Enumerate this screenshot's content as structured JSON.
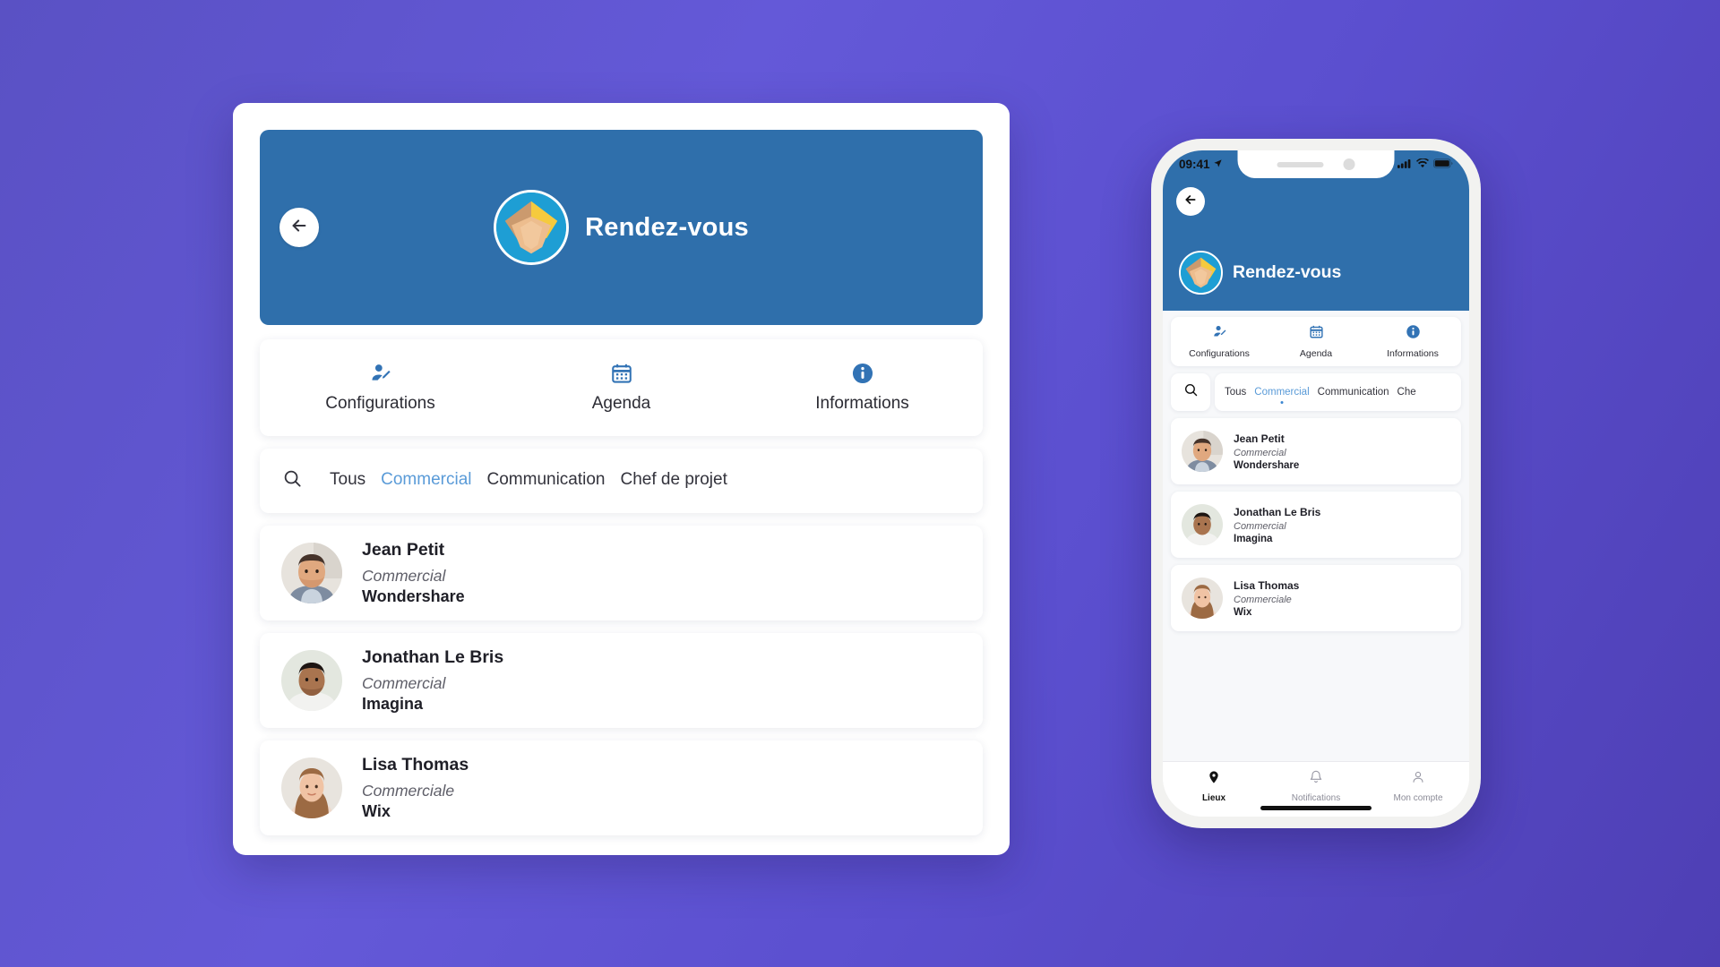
{
  "theme": {
    "page_background": "#5a51c4",
    "header_blue": "#2f6fab",
    "accent_blue": "#3b86d1",
    "active_chip_color": "#5a9bd8",
    "card_white": "#ffffff"
  },
  "desktop": {
    "back_button_icon": "arrow-left-icon",
    "header": {
      "title": "Rendez-vous",
      "logo_icon": "handshake-logo"
    },
    "tabs": [
      {
        "label": "Configurations",
        "icon": "user-edit-icon"
      },
      {
        "label": "Agenda",
        "icon": "calendar-icon"
      },
      {
        "label": "Informations",
        "icon": "info-circle-icon"
      }
    ],
    "filter": {
      "search_icon": "search-icon",
      "chips": [
        {
          "label": "Tous",
          "active": false
        },
        {
          "label": "Commercial",
          "active": true
        },
        {
          "label": "Communication",
          "active": false
        },
        {
          "label": "Chef de projet",
          "active": false
        }
      ]
    },
    "contacts": [
      {
        "name": "Jean Petit",
        "role": "Commercial",
        "organization": "Wondershare",
        "avatar": "photo-man-beard"
      },
      {
        "name": "Jonathan Le Bris",
        "role": "Commercial",
        "organization": "Imagina",
        "avatar": "photo-man-dark"
      },
      {
        "name": "Lisa Thomas",
        "role": "Commerciale",
        "organization": "Wix",
        "avatar": "photo-woman"
      }
    ]
  },
  "phone": {
    "statusbar": {
      "time": "09:41",
      "location_icon": "location-arrow-icon",
      "signal_icon": "cellular-bars-icon",
      "wifi_icon": "wifi-icon",
      "battery_icon": "battery-full-icon"
    },
    "back_button_icon": "arrow-left-icon",
    "header": {
      "title": "Rendez-vous",
      "logo_icon": "handshake-logo"
    },
    "tabs": [
      {
        "label": "Configurations",
        "icon": "user-edit-icon"
      },
      {
        "label": "Agenda",
        "icon": "calendar-icon"
      },
      {
        "label": "Informations",
        "icon": "info-circle-icon"
      }
    ],
    "filter": {
      "search_icon": "search-icon",
      "chips": [
        {
          "label": "Tous",
          "active": false
        },
        {
          "label": "Commercial",
          "active": true
        },
        {
          "label": "Communication",
          "active": false
        },
        {
          "label": "Che",
          "active": false
        }
      ]
    },
    "contacts": [
      {
        "name": "Jean Petit",
        "role": "Commercial",
        "organization": "Wondershare",
        "avatar": "photo-man-beard"
      },
      {
        "name": "Jonathan Le Bris",
        "role": "Commercial",
        "organization": "Imagina",
        "avatar": "photo-man-dark"
      },
      {
        "name": "Lisa Thomas",
        "role": "Commerciale",
        "organization": "Wix",
        "avatar": "photo-woman"
      }
    ],
    "bottom_nav": [
      {
        "label": "Lieux",
        "icon": "map-pin-icon",
        "active": true
      },
      {
        "label": "Notifications",
        "icon": "bell-icon",
        "active": false
      },
      {
        "label": "Mon compte",
        "icon": "person-icon",
        "active": false
      }
    ]
  }
}
